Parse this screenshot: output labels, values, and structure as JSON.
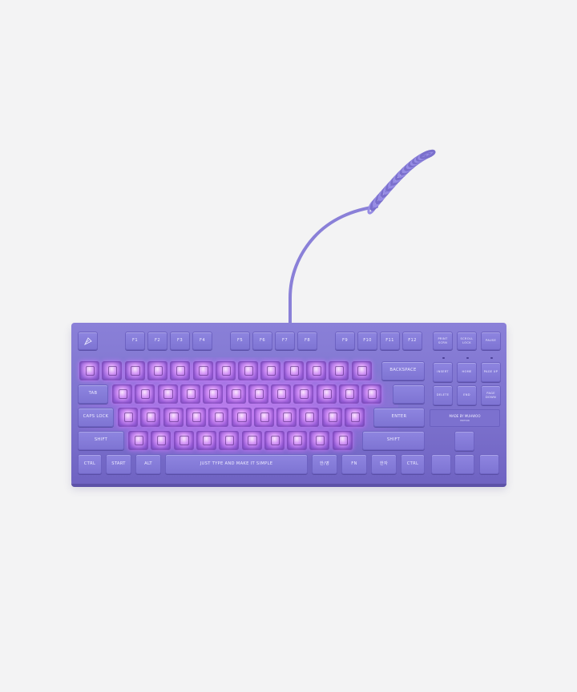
{
  "colors": {
    "background": "#f3f3f4",
    "keyboard_body": "#7d72ce",
    "keycap": "#8a80d8",
    "backlight": "#e09cff",
    "cable": "#8a80d8"
  },
  "keyboard": {
    "logo_icon": "feather-logo-icon",
    "function_row": [
      "F1",
      "F2",
      "F3",
      "F4",
      "F5",
      "F6",
      "F7",
      "F8",
      "F9",
      "F10",
      "F11",
      "F12"
    ],
    "nav_top": [
      "PRINT SCRN",
      "SCROLL LOCK",
      "PAUSE"
    ],
    "nav_mid_1": [
      "INSERT",
      "HOME",
      "PAGE UP"
    ],
    "nav_mid_2": [
      "DELETE",
      "END",
      "PAGE DOWN"
    ],
    "backspace_label": "BACKSPACE",
    "tab_label": "TAB",
    "caps_label": "CAPS LOCK",
    "enter_label": "ENTER",
    "shift_left_label": "SHIFT",
    "shift_right_label": "SHIFT",
    "ctrl_left_label": "CTRL",
    "start_label": "START",
    "alt_label": "ALT",
    "space_label": "JUST TYPE AND MAKE IT SIMPLE",
    "hangul_label": "한/영",
    "fn_label": "FN",
    "hanja_label": "한자",
    "ctrl_right_label": "CTRL",
    "plate_title": "MADE BY MUHWOO",
    "plate_sub": "EDITION"
  }
}
